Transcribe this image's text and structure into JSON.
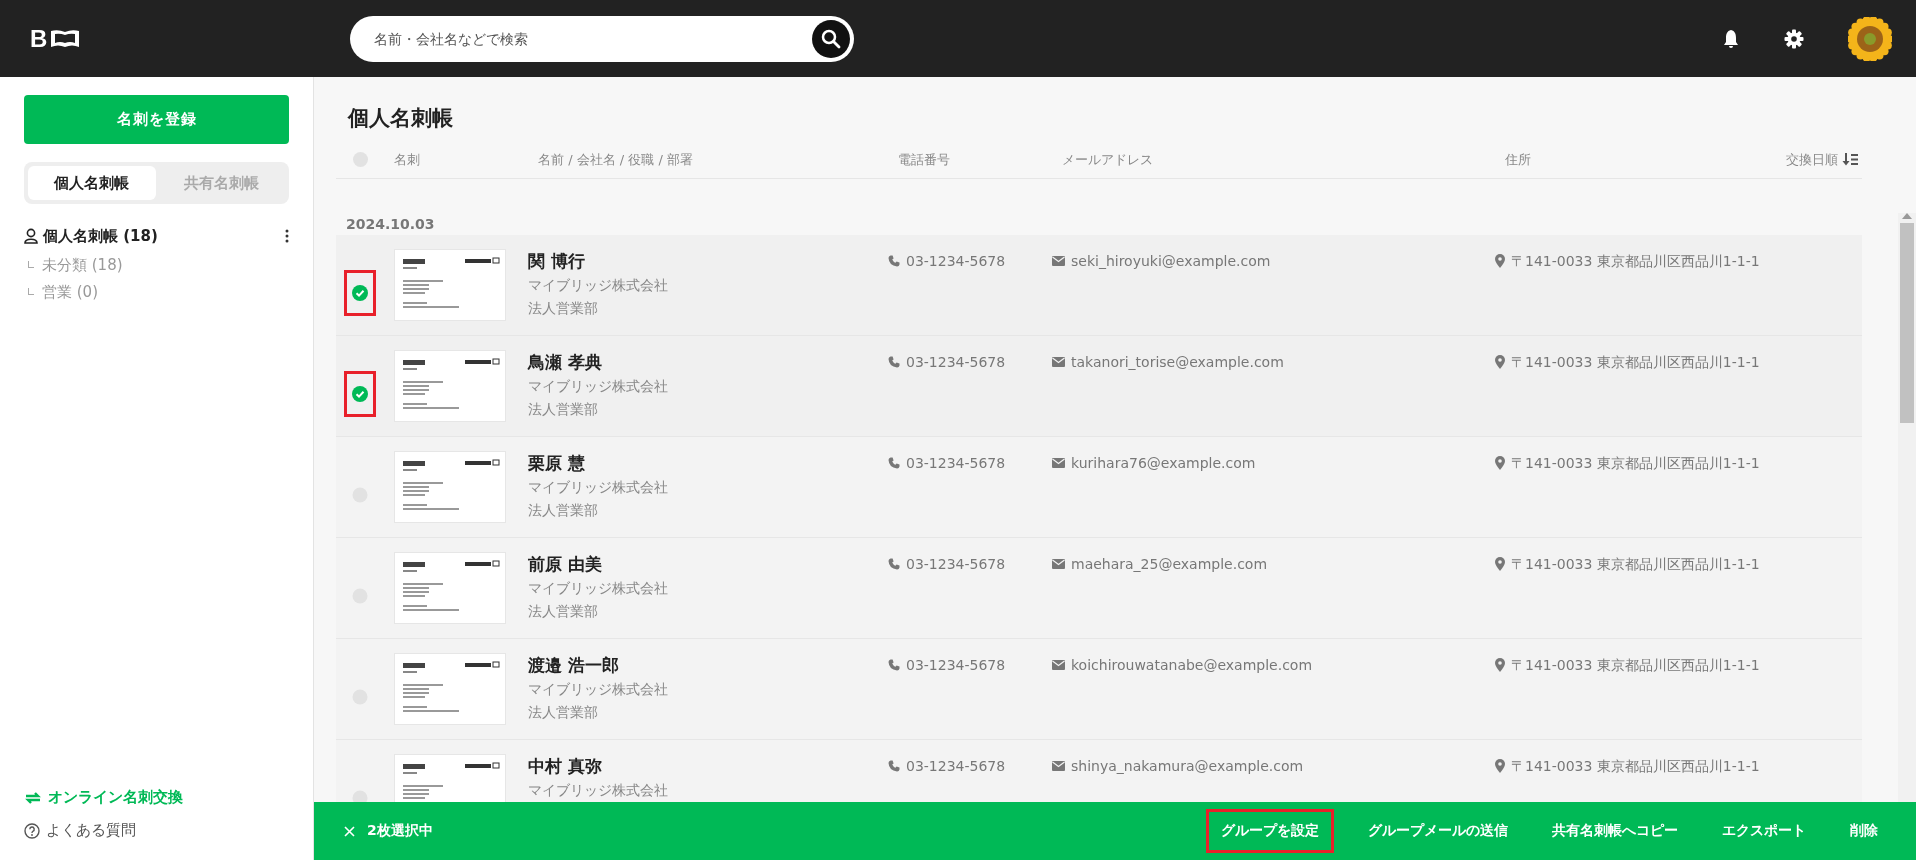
{
  "header": {
    "logo": "B",
    "search": {
      "placeholder": "名前・会社名などで検索"
    }
  },
  "sidebar": {
    "register_button": "名刺を登録",
    "tabs": [
      {
        "label": "個人名刺帳",
        "selected": true
      },
      {
        "label": "共有名刺帳",
        "selected": false
      }
    ],
    "tree": [
      {
        "label": "個人名刺帳 (18)",
        "children": [
          {
            "label": "未分類 (18)"
          },
          {
            "label": "営業 (0)"
          }
        ]
      }
    ],
    "links": [
      {
        "label": "オンライン名刺交換",
        "kind": "exchange"
      },
      {
        "label": "よくある質問",
        "kind": "help"
      }
    ]
  },
  "main": {
    "title": "個人名刺帳",
    "all_selected": false,
    "columns": [
      "名刺",
      "名前 / 会社名 / 役職 / 部署",
      "電話番号",
      "メールアドレス",
      "住所"
    ],
    "sort": "交換日順",
    "groups": [
      {
        "date": "2024.10.03",
        "rows": [
          {
            "name": "関 博行",
            "company": "マイブリッジ株式会社",
            "department": "法人営業部",
            "phone": "03-1234-5678",
            "email": "seki_hiroyuki@example.com",
            "address": "〒141-0033 東京都品川区西品川1-1-1",
            "selected": true,
            "highlighted": true
          },
          {
            "name": "鳥瀬 孝典",
            "company": "マイブリッジ株式会社",
            "department": "法人営業部",
            "phone": "03-1234-5678",
            "email": "takanori_torise@example.com",
            "address": "〒141-0033 東京都品川区西品川1-1-1",
            "selected": true,
            "highlighted": true
          },
          {
            "name": "栗原 慧",
            "company": "マイブリッジ株式会社",
            "department": "法人営業部",
            "phone": "03-1234-5678",
            "email": "kurihara76@example.com",
            "address": "〒141-0033 東京都品川区西品川1-1-1",
            "selected": false,
            "highlighted": false
          },
          {
            "name": "前原 由美",
            "company": "マイブリッジ株式会社",
            "department": "法人営業部",
            "phone": "03-1234-5678",
            "email": "maehara_25@example.com",
            "address": "〒141-0033 東京都品川区西品川1-1-1",
            "selected": false,
            "highlighted": false
          },
          {
            "name": "渡邉 浩一郎",
            "company": "マイブリッジ株式会社",
            "department": "法人営業部",
            "phone": "03-1234-5678",
            "email": "koichirouwatanabe@example.com",
            "address": "〒141-0033 東京都品川区西品川1-1-1",
            "selected": false,
            "highlighted": false
          },
          {
            "name": "中村 真弥",
            "company": "マイブリッジ株式会社",
            "phone": "03-1234-5678",
            "email": "shinya_nakamura@example.com",
            "address": "〒141-0033 東京都品川区西品川1-1-1",
            "selected": false,
            "highlighted": false
          }
        ]
      }
    ]
  },
  "action_bar": {
    "count": "2枚選択中",
    "actions": [
      {
        "label": "グループを設定",
        "highlighted": true
      },
      {
        "label": "グループメールの送信",
        "highlighted": false
      },
      {
        "label": "共有名刺帳へコピー",
        "highlighted": false
      },
      {
        "label": "エクスポート",
        "highlighted": false
      },
      {
        "label": "削除",
        "highlighted": false
      }
    ]
  }
}
